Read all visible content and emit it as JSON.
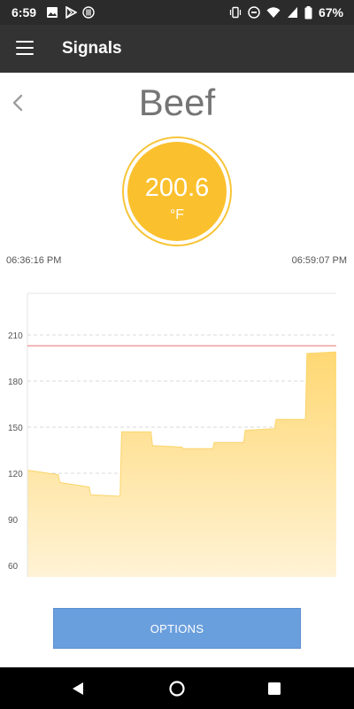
{
  "status_bar": {
    "time": "6:59",
    "battery": "67%",
    "icons": [
      "image-icon",
      "play-store-icon",
      "thermometer-app-icon",
      "vibrate-icon",
      "do-not-disturb-icon",
      "wifi-icon",
      "signal-icon",
      "battery-icon"
    ]
  },
  "app_bar": {
    "title": "Signals",
    "menu_icon": "hamburger-menu-icon"
  },
  "probe": {
    "name": "Beef",
    "temperature": "200.6",
    "unit": "°F"
  },
  "timestamps": {
    "start": "06:36:16 PM",
    "end": "06:59:07 PM"
  },
  "colors": {
    "gauge": "#fbc02d",
    "fill": "#ffe08a",
    "alarm_line": "#e57373",
    "button": "#6a9fde",
    "app_bar": "#333333"
  },
  "chart_data": {
    "type": "area",
    "x_label_start": "06:36:16 PM",
    "x_label_end": "06:59:07 PM",
    "ylim": [
      55,
      220
    ],
    "y_ticks": [
      60,
      90,
      120,
      150,
      180,
      210
    ],
    "grid": "horizontal dashed",
    "alarm_line": 203,
    "points": [
      [
        0,
        122
      ],
      [
        1,
        119
      ],
      [
        1.05,
        114
      ],
      [
        2,
        111
      ],
      [
        2.05,
        106
      ],
      [
        3,
        105
      ],
      [
        3.05,
        147
      ],
      [
        4,
        147
      ],
      [
        4.05,
        138
      ],
      [
        5,
        137
      ],
      [
        5.05,
        136
      ],
      [
        6,
        136
      ],
      [
        6.05,
        140
      ],
      [
        7,
        140
      ],
      [
        7.05,
        148
      ],
      [
        8,
        149
      ],
      [
        8.05,
        155
      ],
      [
        9,
        155
      ],
      [
        9.05,
        198
      ],
      [
        10,
        199
      ]
    ]
  },
  "actions": {
    "options_label": "OPTIONS"
  },
  "nav": {
    "back": "back-icon",
    "home": "home-icon",
    "recents": "recents-icon"
  }
}
